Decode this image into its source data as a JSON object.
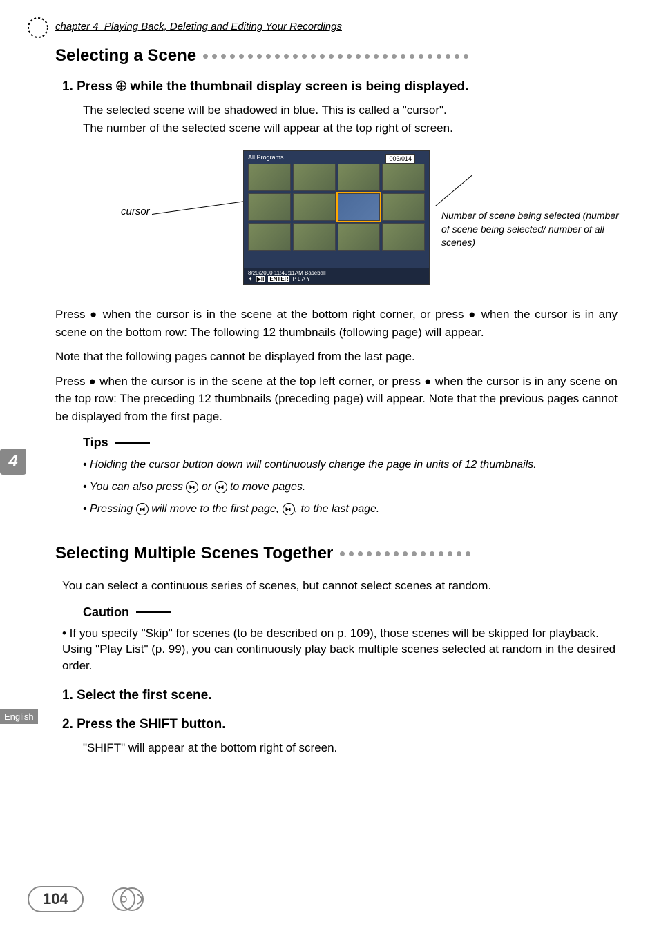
{
  "chapter_header": "chapter 4_Playing Back, Deleting and Editing Your Recordings",
  "section1": {
    "title": "Selecting a Scene",
    "step1_header": "1.  Press 🕀 while the thumbnail display screen is being displayed.",
    "step1_text1": "The selected scene will be shadowed in blue. This is called a \"cursor\".",
    "step1_text2": "The number of the selected scene will appear at the top right of screen.",
    "cursor_label": "cursor",
    "annotation_right": "Number of scene being selected (number of scene being selected/ number of all scenes)",
    "screen": {
      "title": "All Programs",
      "counter": "003/014",
      "footer_line1": "8/20/2000  11:49:11AM      Baseball",
      "footer_enter": "ENTER",
      "footer_play": "P L A Y"
    },
    "para1": "Press ● when the cursor is in the scene at the bottom right corner, or press ● when the cursor is in any scene on the bottom row: The following 12 thumbnails (following page) will appear.",
    "para2": "Note that the following pages cannot be displayed from the last page.",
    "para3": "Press ● when the cursor is in the scene at the top left corner, or press ● when the cursor is in any scene on the top row: The preceding 12 thumbnails (preceding page) will appear. Note that the previous pages cannot be displayed from the first page.",
    "tips_header": "Tips",
    "tip1": "•  Holding the cursor button down will continuously change the page in units of 12 thumbnails.",
    "tip2_a": "•  You can also press ",
    "tip2_b": " or ",
    "tip2_c": " to move pages.",
    "tip3_a": "•  Pressing ",
    "tip3_b": " will move to the first page, ",
    "tip3_c": ", to the last page."
  },
  "section2": {
    "title": "Selecting Multiple Scenes Together",
    "intro": "You can select a continuous series of scenes, but cannot select scenes at random.",
    "caution_header": "Caution",
    "caution_text": "•  If you specify \"Skip\" for scenes (to be described on p. 109), those scenes will be skipped for playback. Using \"Play List\" (p. 99), you can continuously play back multiple scenes selected at random in the desired order.",
    "step1": "1.  Select the first scene.",
    "step2": "2.  Press the SHIFT button.",
    "step2_text": "\"SHIFT\" will appear at the bottom right of screen."
  },
  "left_chapter_marker": "4",
  "english_label": "English",
  "page_number": "104"
}
